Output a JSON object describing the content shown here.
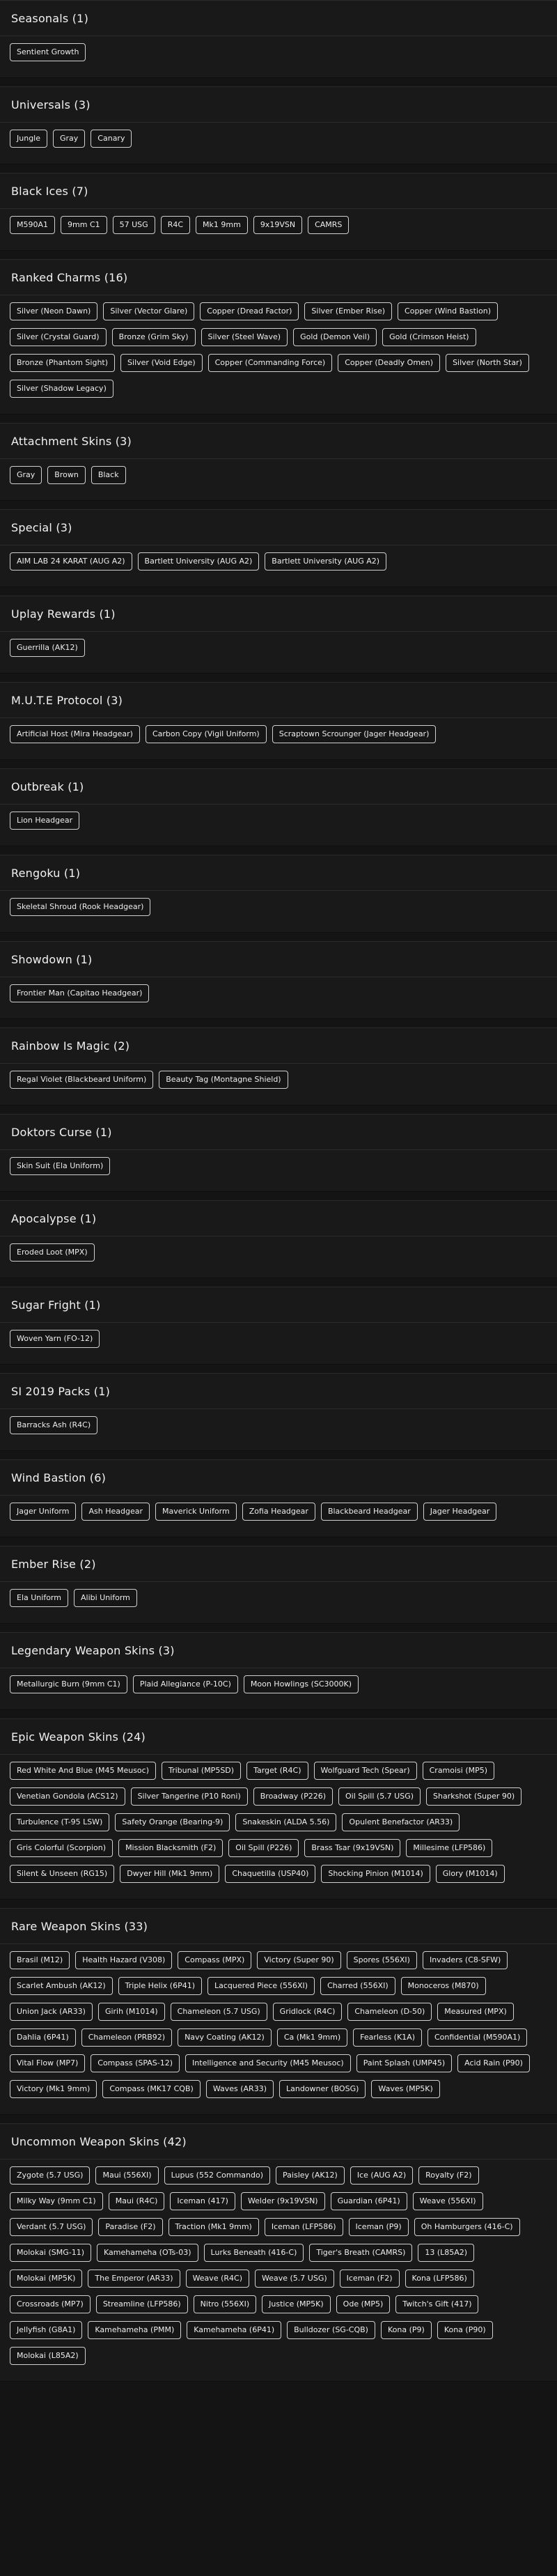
{
  "sections": [
    {
      "title": "Seasonals (1)",
      "items": [
        "Sentient Growth"
      ]
    },
    {
      "title": "Universals (3)",
      "items": [
        "Jungle",
        "Gray",
        "Canary"
      ]
    },
    {
      "title": "Black Ices (7)",
      "items": [
        "M590A1",
        "9mm C1",
        "57 USG",
        "R4C",
        "Mk1 9mm",
        "9x19VSN",
        "CAMRS"
      ]
    },
    {
      "title": "Ranked Charms (16)",
      "items": [
        "Silver (Neon Dawn)",
        "Silver (Vector Glare)",
        "Copper (Dread Factor)",
        "Silver (Ember Rise)",
        "Copper (Wind Bastion)",
        "Silver (Crystal Guard)",
        "Bronze (Grim Sky)",
        "Silver (Steel Wave)",
        "Gold (Demon Veil)",
        "Gold (Crimson Heist)",
        "Bronze (Phantom Sight)",
        "Silver (Void Edge)",
        "Copper (Commanding Force)",
        "Copper (Deadly Omen)",
        "Silver (North Star)",
        "Silver (Shadow Legacy)"
      ]
    },
    {
      "title": "Attachment Skins (3)",
      "items": [
        "Gray",
        "Brown",
        "Black"
      ]
    },
    {
      "title": "Special (3)",
      "items": [
        "AIM LAB 24 KARAT (AUG A2)",
        "Bartlett University (AUG A2)",
        "Bartlett University (AUG A2)"
      ]
    },
    {
      "title": "Uplay Rewards (1)",
      "items": [
        "Guerrilla (AK12)"
      ]
    },
    {
      "title": "M.U.T.E Protocol (3)",
      "items": [
        "Artificial Host (Mira Headgear)",
        "Carbon Copy (Vigil Uniform)",
        "Scraptown Scrounger (Jager Headgear)"
      ]
    },
    {
      "title": "Outbreak (1)",
      "items": [
        "Lion Headgear"
      ]
    },
    {
      "title": "Rengoku (1)",
      "items": [
        "Skeletal Shroud (Rook Headgear)"
      ]
    },
    {
      "title": "Showdown (1)",
      "items": [
        "Frontier Man (Capitao Headgear)"
      ]
    },
    {
      "title": "Rainbow Is Magic (2)",
      "items": [
        "Regal Violet (Blackbeard Uniform)",
        "Beauty Tag (Montagne Shield)"
      ]
    },
    {
      "title": "Doktors Curse (1)",
      "items": [
        "Skin Suit (Ela Uniform)"
      ]
    },
    {
      "title": "Apocalypse (1)",
      "items": [
        "Eroded Loot (MPX)"
      ]
    },
    {
      "title": "Sugar Fright (1)",
      "items": [
        "Woven Yarn (FO-12)"
      ]
    },
    {
      "title": "SI 2019 Packs (1)",
      "items": [
        "Barracks Ash (R4C)"
      ]
    },
    {
      "title": "Wind Bastion (6)",
      "items": [
        "Jager Uniform",
        "Ash Headgear",
        "Maverick Uniform",
        "Zofia Headgear",
        "Blackbeard Headgear",
        "Jager Headgear"
      ]
    },
    {
      "title": "Ember Rise (2)",
      "items": [
        "Ela Uniform",
        "Alibi Uniform"
      ]
    },
    {
      "title": "Legendary Weapon Skins (3)",
      "items": [
        "Metallurgic Burn (9mm C1)",
        "Plaid Allegiance (P-10C)",
        "Moon Howlings (SC3000K)"
      ]
    },
    {
      "title": "Epic Weapon Skins (24)",
      "items": [
        "Red White And Blue (M45 Meusoc)",
        "Tribunal (MP5SD)",
        "Target (R4C)",
        "Wolfguard Tech (Spear)",
        "Cramoisi (MP5)",
        "Venetian Gondola (ACS12)",
        "Silver Tangerine (P10 Roni)",
        "Broadway (P226)",
        "Oil Spill (5.7 USG)",
        "Sharkshot (Super 90)",
        "Turbulence (T-95 LSW)",
        "Safety Orange (Bearing-9)",
        "Snakeskin (ALDA 5.56)",
        "Opulent Benefactor (AR33)",
        "Gris Colorful (Scorpion)",
        "Mission Blacksmith (F2)",
        "Oil Spill (P226)",
        "Brass Tsar (9x19VSN)",
        "Millesime (LFP586)",
        "Silent & Unseen (RG15)",
        "Dwyer Hill (Mk1 9mm)",
        "Chaquetilla (USP40)",
        "Shocking Pinion (M1014)",
        "Glory (M1014)"
      ]
    },
    {
      "title": "Rare Weapon Skins (33)",
      "items": [
        "Brasil (M12)",
        "Health Hazard (V308)",
        "Compass (MPX)",
        "Victory (Super 90)",
        "Spores (556XI)",
        "Invaders (C8-SFW)",
        "Scarlet Ambush (AK12)",
        "Triple Helix (6P41)",
        "Lacquered Piece (556XI)",
        "Charred (556XI)",
        "Monoceros (M870)",
        "Union Jack (AR33)",
        "Girih (M1014)",
        "Chameleon (5.7 USG)",
        "Gridlock (R4C)",
        "Chameleon (D-50)",
        "Measured (MPX)",
        "Dahlia (6P41)",
        "Chameleon (PRB92)",
        "Navy Coating (AK12)",
        "Ca (Mk1 9mm)",
        "Fearless (K1A)",
        "Confidential (M590A1)",
        "Vital Flow (MP7)",
        "Compass (SPAS-12)",
        "Intelligence and Security (M45 Meusoc)",
        "Paint Splash (UMP45)",
        "Acid Rain (P90)",
        "Victory (Mk1 9mm)",
        "Compass (MK17 CQB)",
        "Waves (AR33)",
        "Landowner (BOSG)",
        "Waves (MP5K)"
      ]
    },
    {
      "title": "Uncommon Weapon Skins (42)",
      "items": [
        "Zygote (5.7 USG)",
        "Maui (556XI)",
        "Lupus (552 Commando)",
        "Paisley (AK12)",
        "Ice (AUG A2)",
        "Royalty (F2)",
        "Milky Way (9mm C1)",
        "Maui (R4C)",
        "Iceman (417)",
        "Welder (9x19VSN)",
        "Guardian (6P41)",
        "Weave (556XI)",
        "Verdant (5.7 USG)",
        "Paradise (F2)",
        "Traction (Mk1 9mm)",
        "Iceman (LFP586)",
        "Iceman (P9)",
        "Oh Hamburgers (416-C)",
        "Molokai (SMG-11)",
        "Kamehameha (OTs-03)",
        "Lurks Beneath (416-C)",
        "Tiger's Breath (CAMRS)",
        "13 (L85A2)",
        "Molokai (MP5K)",
        "The Emperor (AR33)",
        "Weave (R4C)",
        "Weave (5.7 USG)",
        "Iceman (F2)",
        "Kona (LFP586)",
        "Crossroads (MP7)",
        "Streamline (LFP586)",
        "Nitro (556XI)",
        "Justice (MP5K)",
        "Ode (MP5)",
        "Twitch's Gift (417)",
        "Jellyfish (G8A1)",
        "Kamehameha (PMM)",
        "Kamehameha (6P41)",
        "Bulldozer (SG-CQB)",
        "Kona (P9)",
        "Kona (P90)",
        "Molokai (L85A2)"
      ]
    }
  ]
}
